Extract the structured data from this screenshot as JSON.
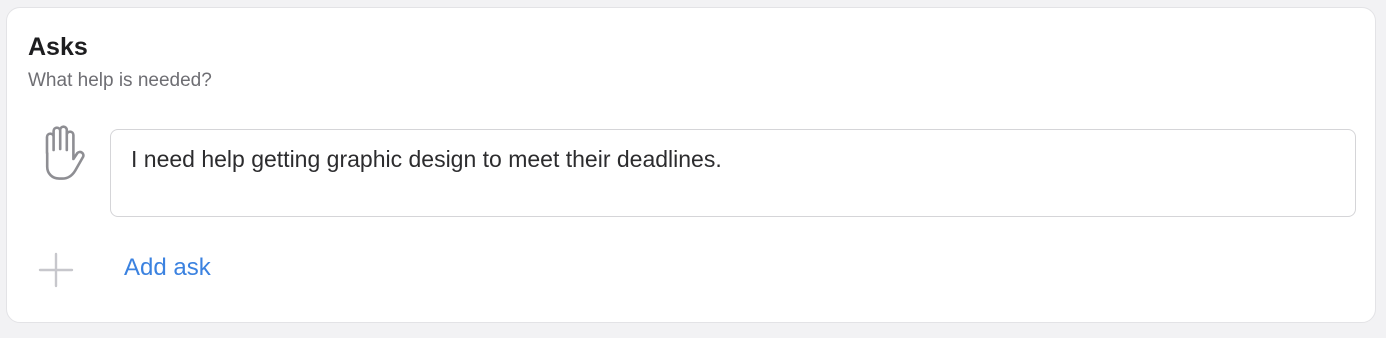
{
  "section": {
    "title": "Asks",
    "subtitle": "What help is needed?"
  },
  "asks": [
    {
      "icon": "raised-hand-icon",
      "text": "I need help getting graphic design to meet their deadlines."
    }
  ],
  "add": {
    "icon": "plus-icon",
    "label": "Add ask"
  },
  "colors": {
    "accent": "#3b82e0",
    "icon_gray": "#8e8e93",
    "plus_gray": "#c7c7cc"
  }
}
